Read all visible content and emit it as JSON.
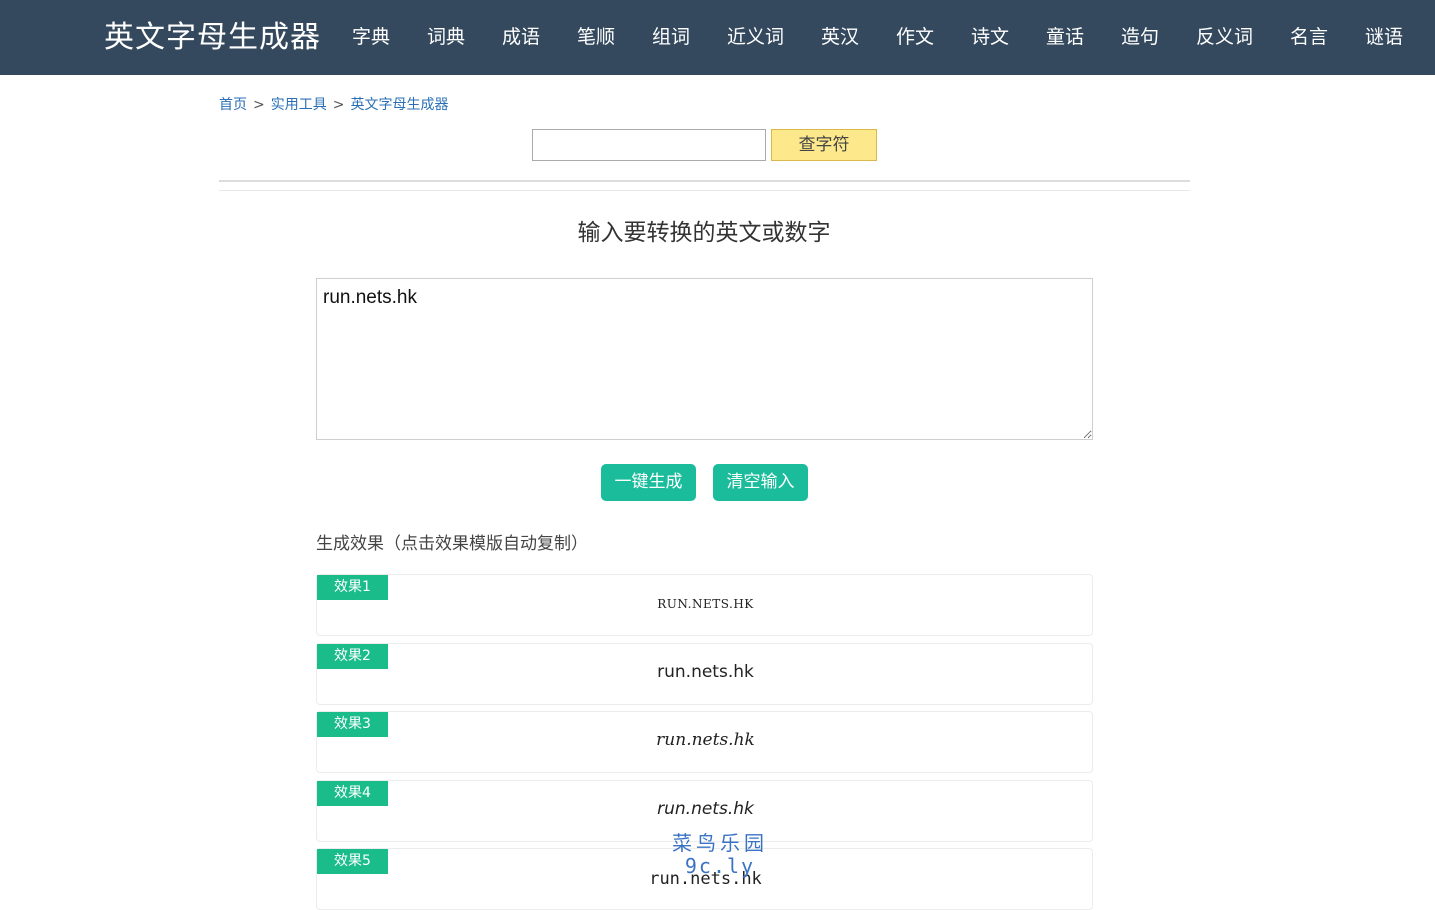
{
  "header": {
    "brand": "英文字母生成器",
    "nav": [
      "字典",
      "词典",
      "成语",
      "笔顺",
      "组词",
      "近义词",
      "英汉",
      "作文",
      "诗文",
      "童话",
      "造句",
      "反义词",
      "名言",
      "谜语"
    ]
  },
  "breadcrumb": {
    "items": [
      "首页",
      "实用工具",
      "英文字母生成器"
    ],
    "separator": ">"
  },
  "search": {
    "value": "",
    "button_label": "查字符"
  },
  "converter": {
    "title": "输入要转换的英文或数字",
    "input_value": "run.nets.hk",
    "generate_label": "一键生成",
    "clear_label": "清空输入",
    "results_label": "生成效果（点击效果模版自动复制）",
    "results": [
      {
        "tag": "效果1",
        "text": "RUN.NETS.HK"
      },
      {
        "tag": "效果2",
        "text": "run.nets.hk"
      },
      {
        "tag": "效果3",
        "text": "run.nets.hk"
      },
      {
        "tag": "效果4",
        "text": "run.nets.hk"
      },
      {
        "tag": "效果5",
        "text": "run.nets.hk"
      }
    ]
  },
  "watermark": {
    "line1": "菜鸟乐园",
    "line2": "9c.ly"
  },
  "colors": {
    "navbar": "#34495e",
    "accent_green": "#1abc9c",
    "tag_green": "#1abc8a",
    "search_button": "#fde98c",
    "link": "#2a6fb5"
  }
}
